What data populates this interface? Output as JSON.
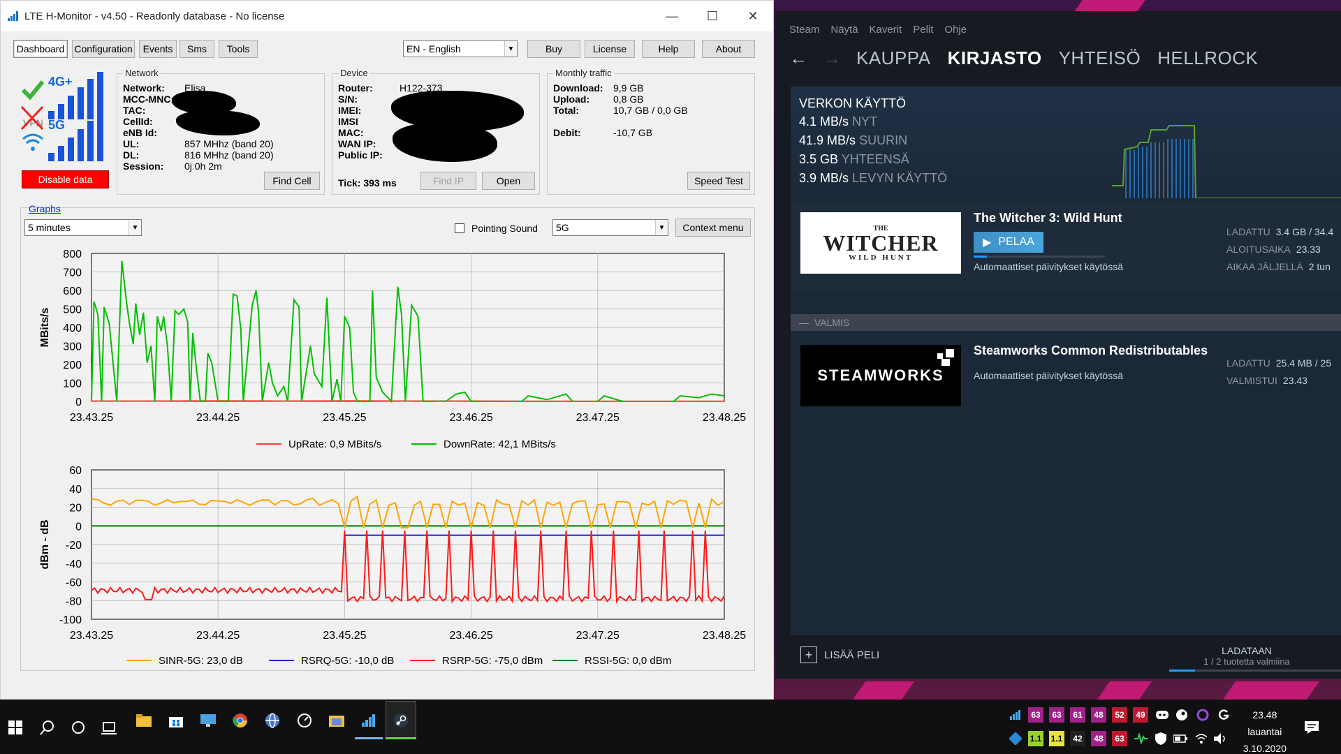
{
  "lte": {
    "title": "LTE H-Monitor - v4.50 - Readonly database - No license",
    "tabs": [
      "Dashboard",
      "Configuration",
      "Events",
      "Sms",
      "Tools"
    ],
    "language": "EN - English",
    "top_buttons": [
      "Buy",
      "License",
      "Help",
      "About"
    ],
    "status_icons": {
      "g4": "4G+",
      "g5": "5G",
      "vpn": "VPN"
    },
    "disable_data": "Disable data",
    "network": {
      "title": "Network",
      "labels": [
        "Network:",
        "MCC-MNC:",
        "TAC:",
        "CellId:",
        "eNB Id:",
        "UL:",
        "DL:",
        "Session:"
      ],
      "values": [
        "Elisa",
        "",
        "",
        "",
        "",
        "857 MHhz (band 20)",
        "816 MHhz (band 20)",
        "0j 0h 2m"
      ],
      "button": "Find Cell"
    },
    "device": {
      "title": "Device",
      "labels": [
        "Router:",
        "S/N:",
        "IMEI:",
        "IMSI",
        "MAC:",
        "WAN IP:",
        "Public IP:"
      ],
      "values": [
        "H122-373",
        "",
        "",
        "",
        "",
        "",
        ""
      ],
      "tick": "Tick: 393 ms",
      "buttons": [
        "Find IP",
        "Open"
      ]
    },
    "traffic": {
      "title": "Monthly traffic",
      "labels": [
        "Download:",
        "Upload:",
        "Total:",
        "Debit:"
      ],
      "values": [
        "9,9 GB",
        "0,8 GB",
        "10,7 GB / 0,0 GB",
        "-10,7 GB"
      ],
      "button": "Speed Test"
    },
    "graphs": {
      "title": "Graphs",
      "period": "5 minutes",
      "pointing_sound": "Pointing Sound",
      "network_select": "5G",
      "context_button": "Context menu"
    }
  },
  "chart_data": [
    {
      "type": "line",
      "ylabel": "MBits/s",
      "ylim": [
        0,
        800
      ],
      "yticks": [
        "800",
        "700",
        "600",
        "500",
        "400",
        "300",
        "200",
        "100",
        "0"
      ],
      "xticks": [
        "23.43.25",
        "23.44.25",
        "23.45.25",
        "23.46.25",
        "23.47.25",
        "23.48.25"
      ],
      "series": [
        {
          "name": "UpRate: 0,9 MBits/s",
          "color": "#ff3b3b",
          "points": [
            [
              0,
              2
            ],
            [
              0.5,
              2
            ],
            [
              1,
              3
            ],
            [
              1.5,
              2
            ],
            [
              2,
              3
            ],
            [
              2.5,
              2
            ],
            [
              3,
              2
            ],
            [
              3.5,
              1
            ],
            [
              4,
              1
            ],
            [
              4.5,
              1
            ],
            [
              5,
              1
            ]
          ]
        },
        {
          "name": "DownRate: 42,1 MBits/s",
          "color": "#00c000",
          "points": [
            [
              0,
              0
            ],
            [
              0.02,
              540
            ],
            [
              0.05,
              470
            ],
            [
              0.08,
              0
            ],
            [
              0.1,
              510
            ],
            [
              0.14,
              420
            ],
            [
              0.2,
              0
            ],
            [
              0.24,
              760
            ],
            [
              0.28,
              520
            ],
            [
              0.3,
              420
            ],
            [
              0.33,
              310
            ],
            [
              0.35,
              530
            ],
            [
              0.38,
              360
            ],
            [
              0.41,
              480
            ],
            [
              0.44,
              210
            ],
            [
              0.47,
              300
            ],
            [
              0.5,
              0
            ],
            [
              0.52,
              460
            ],
            [
              0.55,
              380
            ],
            [
              0.57,
              460
            ],
            [
              0.6,
              300
            ],
            [
              0.63,
              0
            ],
            [
              0.66,
              490
            ],
            [
              0.69,
              470
            ],
            [
              0.73,
              500
            ],
            [
              0.76,
              430
            ],
            [
              0.78,
              0
            ],
            [
              0.8,
              370
            ],
            [
              0.83,
              170
            ],
            [
              0.86,
              0
            ],
            [
              0.9,
              0
            ],
            [
              0.92,
              260
            ],
            [
              0.95,
              210
            ],
            [
              1.0,
              0
            ],
            [
              1.08,
              0
            ],
            [
              1.12,
              580
            ],
            [
              1.15,
              570
            ],
            [
              1.18,
              390
            ],
            [
              1.2,
              0
            ],
            [
              1.27,
              520
            ],
            [
              1.3,
              600
            ],
            [
              1.32,
              480
            ],
            [
              1.35,
              0
            ],
            [
              1.4,
              210
            ],
            [
              1.43,
              100
            ],
            [
              1.47,
              30
            ],
            [
              1.52,
              80
            ],
            [
              1.55,
              0
            ],
            [
              1.6,
              550
            ],
            [
              1.64,
              510
            ],
            [
              1.66,
              0
            ],
            [
              1.73,
              300
            ],
            [
              1.76,
              150
            ],
            [
              1.82,
              80
            ],
            [
              1.86,
              560
            ],
            [
              1.9,
              0
            ],
            [
              1.94,
              120
            ],
            [
              1.97,
              0
            ],
            [
              2.0,
              460
            ],
            [
              2.04,
              400
            ],
            [
              2.07,
              50
            ],
            [
              2.1,
              0
            ],
            [
              2.2,
              0
            ],
            [
              2.22,
              600
            ],
            [
              2.25,
              130
            ],
            [
              2.3,
              50
            ],
            [
              2.37,
              0
            ],
            [
              2.42,
              620
            ],
            [
              2.45,
              470
            ],
            [
              2.48,
              0
            ],
            [
              2.53,
              520
            ],
            [
              2.58,
              460
            ],
            [
              2.62,
              0
            ],
            [
              2.7,
              0
            ],
            [
              2.75,
              2
            ],
            [
              2.8,
              0
            ],
            [
              2.88,
              40
            ],
            [
              2.95,
              50
            ],
            [
              3.0,
              0
            ],
            [
              3.4,
              0
            ],
            [
              3.45,
              30
            ],
            [
              3.6,
              10
            ],
            [
              3.75,
              40
            ],
            [
              3.8,
              0
            ],
            [
              4.0,
              0
            ],
            [
              4.05,
              30
            ],
            [
              4.2,
              0
            ],
            [
              4.6,
              0
            ],
            [
              4.65,
              30
            ],
            [
              4.8,
              20
            ],
            [
              4.9,
              40
            ],
            [
              5.0,
              30
            ]
          ]
        }
      ]
    },
    {
      "type": "line",
      "ylabel": "dBm - dB",
      "ylim": [
        -100,
        60
      ],
      "yticks": [
        "60",
        "40",
        "20",
        "0",
        "-20",
        "-40",
        "-60",
        "-80",
        "-100"
      ],
      "xticks": [
        "23.43.25",
        "23.44.25",
        "23.45.25",
        "23.46.25",
        "23.47.25",
        "23.48.25"
      ],
      "series": [
        {
          "name": "SINR-5G: 23,0 dB",
          "color": "#ffa500",
          "level": 25
        },
        {
          "name": "RSRQ-5G: -10,0 dB",
          "color": "#1f1fe0",
          "level": -10
        },
        {
          "name": "RSRP-5G: -75,0 dBm",
          "color": "#ff1a1a",
          "level": -75
        },
        {
          "name": "RSSI-5G: 0,0 dBm",
          "color": "#008000",
          "level": 0
        }
      ]
    }
  ],
  "steam": {
    "menu": [
      "Steam",
      "Näytä",
      "Kaverit",
      "Pelit",
      "Ohje"
    ],
    "nav": [
      "KAUPPA",
      "KIRJASTO",
      "YHTEISÖ",
      "HELLROCK"
    ],
    "network": {
      "title": "VERKON KÄYTTÖ",
      "rows": [
        {
          "value": "4.1 MB/s",
          "unit": "NYT"
        },
        {
          "value": "41.9 MB/s",
          "unit": "SUURIN"
        },
        {
          "value": "3.5 GB",
          "unit": "YHTEENSÄ"
        },
        {
          "value": "3.9 MB/s",
          "unit": "LEVYN KÄYTTÖ"
        }
      ]
    },
    "witcher": {
      "name": "The Witcher 3: Wild Hunt",
      "logo_top": "THE",
      "logo_main": "WITCHER",
      "logo_sub": "WILD HUNT",
      "play": "PELAA",
      "auto": "Automaattiset päivitykset käytössä",
      "stats": [
        {
          "label": "LADATTU",
          "value": "3.4 GB / 34.4"
        },
        {
          "label": "ALOITUSAIKA",
          "value": "23.33"
        },
        {
          "label": "AIKAA JÄLJELLÄ",
          "value": "2 tun"
        }
      ]
    },
    "section": "VALMIS",
    "steamworks": {
      "name": "Steamworks Common Redistributables",
      "logo": "STEAMWORKS",
      "auto": "Automaattiset päivitykset käytössä",
      "stats": [
        {
          "label": "LADATTU",
          "value": "25.4 MB / 25"
        },
        {
          "label": "VALMISTUI",
          "value": "23.43"
        }
      ]
    },
    "add_game": "LISÄÄ PELI",
    "loading": "LADATAAN",
    "loading_sub": "1 / 2 tuotetta valmiina"
  },
  "taskbar": {
    "tray_top": [
      "63",
      "63",
      "61",
      "48",
      "52",
      "49"
    ],
    "tray_bottom": [
      "1.1",
      "1.1",
      "42",
      "48",
      "63"
    ],
    "time": "23.48",
    "day": "lauantai",
    "date": "3.10.2020"
  }
}
